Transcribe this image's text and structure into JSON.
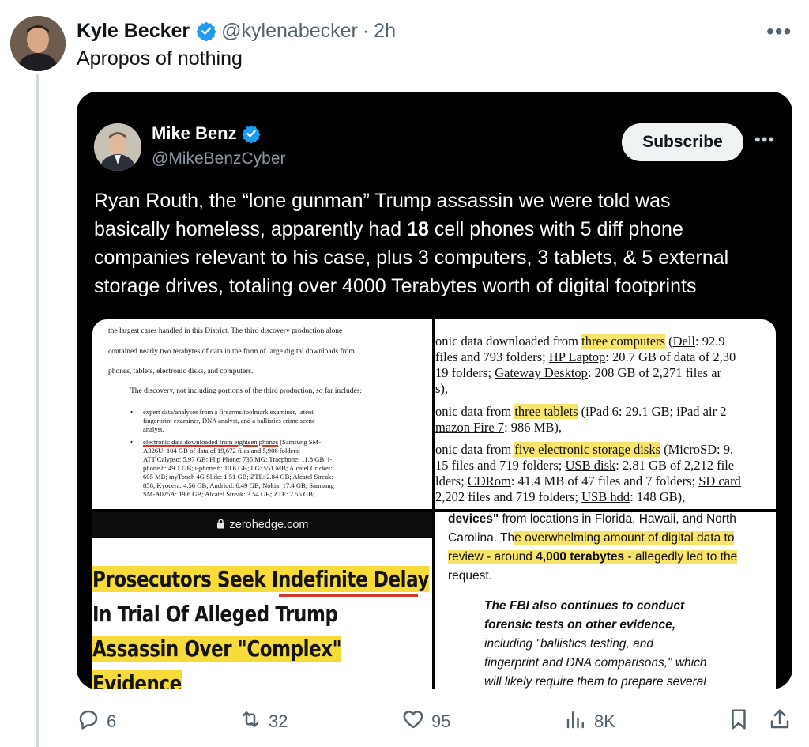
{
  "tweet": {
    "author_name": "Kyle Becker",
    "author_handle": "@kylenabecker",
    "separator": "·",
    "time": "2h",
    "text": "Apropos of nothing"
  },
  "embedded": {
    "author_name": "Mike Benz",
    "author_handle": "@MikeBenzCyber",
    "subscribe_label": "Subscribe",
    "text_lines": [
      "Ryan Routh, the “lone gunman” Trump assassin we were told was",
      "basically homeless, apparently had ",
      "18",
      " cell phones with 5 diff phone",
      "companies relevant to his case, plus 3 computers, 3 tablets, & 5 external",
      "storage drives, totaling over 4000 Terabytes worth of digital footprints"
    ]
  },
  "media": {
    "doc_left": [
      "the largest cases handled in this District. The third discovery production alone",
      "contained nearly two terabytes of data in the form of large digital downloads from",
      "phones, tablets, electronic disks, and computers.",
      "The discovery, not including portions of the third production, so far includes:",
      "expert data/analyses from a firearms/toolmark examiner, latent",
      "fingerprint examiner, DNA analyst, and a ballistics crime scene",
      "analyst,",
      "electronic data downloaded from eighteen phones",
      " (Samsung SM-",
      "A326U: 104 GB of data of 19,672 files and 5,906 folders;",
      "ATT Calypso: 5.97 GB; Flip Phone: 735 MG; Tracphone: 11.8 GB; i-",
      "phone 8: 49.1 GB; i-phone 6: 10.6 GB; LG: 551 MB; Alcatel Cricket:",
      "605 MB; myTouch 4G Slide: 1.51 GB; ZTE: 2.84 GB; Alcatel Streak:",
      "856; Kyocera: 4.56 GB; Andriod: 6.49 GB; Nokia: 17.4 GB; Samsung",
      "SM-A025A: 19.6 GB; Alcatel Streak: 3.54 GB; ZTE: 2.55 GB;"
    ],
    "doc_right": [
      "onic data downloaded from ",
      "three computers",
      " (",
      "Dell",
      ": 92.9",
      "files and 793 folders; ",
      "HP Laptop",
      ": 20.7 GB of data of 2,30",
      "19 folders; ",
      "Gateway Desktop",
      ": 208 GB of 2,271 files ar",
      "s),",
      "onic data from ",
      "three tablets",
      " (",
      "iPad 6",
      ": 29.1 GB; ",
      "iPad air 2",
      "mazon Fire 7",
      ": 986 MB),",
      "onic data from ",
      "five electronic storage disks",
      " (",
      "MicroSD",
      ": 9.",
      "15 files and 719 folders; ",
      "USB disk",
      ": 2.81 GB of 2,212 file",
      "lders; ",
      "CDRom",
      ": 41.4 MB of 47 files and 7 folders; ",
      "SD card",
      "2,202 files and 719 folders; ",
      "USB hdd",
      ": 148 GB),"
    ],
    "zh_domain": "zerohedge.com",
    "zh_headline": [
      "Prosecutors Seek Indefinite Delay",
      "In Trial Of Alleged Trump",
      "Assassin Over \"Complex\"",
      "Evidence"
    ],
    "article": {
      "l1a": "devices\"",
      "l1b": " from locations in Florida, Hawaii, and North",
      "l2a": "Carolina. Th",
      "l2b": "e overwhelming amount of digital data to",
      "l3a": "review - around ",
      "l3b": "4,000 terabytes",
      "l3c": " - allegedly led to the",
      "l4": "request.",
      "q1": "The FBI also continues to conduct",
      "q2": "forensic tests on other evidence,",
      "q3": "including \"ballistics testing, and",
      "q4": "fingerprint and DNA comparisons,\" which",
      "q5": "will likely require them to prepare several"
    }
  },
  "actions": {
    "replies": "6",
    "reposts": "32",
    "likes": "95",
    "views": "8K"
  },
  "colors": {
    "verified": "#1d9bf0",
    "highlight": "#f7e46b",
    "muted": "#536471"
  }
}
